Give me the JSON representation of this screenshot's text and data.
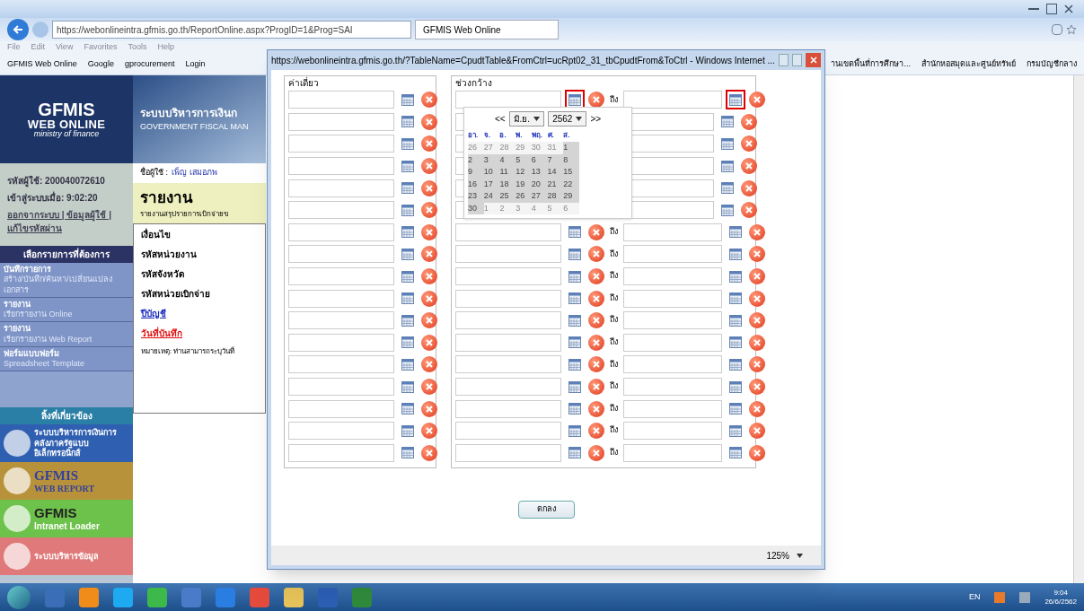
{
  "browser": {
    "address": "https://webonlineintra.gfmis.go.th/ReportOnline.aspx?ProgID=1&Prog=SAI",
    "tab": "GFMIS Web Online",
    "menu": [
      "File",
      "Edit",
      "View",
      "Favorites",
      "Tools",
      "Help"
    ],
    "favorites": [
      "GFMIS Web Online",
      "Google",
      "gprocurement",
      "Login"
    ],
    "favorites_right": [
      "านเขตพื้นที่การศึกษา...",
      "สำนักหอสมุดและศูนย์ทรัพย์",
      "กรมบัญชีกลาง"
    ]
  },
  "page": {
    "logo": {
      "line_1": "GFMIS",
      "line_2": "WEB ONLINE",
      "line_3": "ministry of finance"
    },
    "header": {
      "title": "ระบบบริหารการเงินก",
      "subtitle": "GOVERNMENT FISCAL MAN"
    },
    "user_info": [
      "รหัสผู้ใช้: 200040072610",
      "เข้าสู่ระบบเมื่อ: 9:02:20"
    ],
    "user_links": "ออกจากระบบ | ข้อมูลผู้ใช้ | แก้ไขรหัสผ่าน",
    "menu_heading": "เลือกรายการที่ต้องการ",
    "menu": [
      {
        "title": "บันทึกรายการ",
        "subtitle": "สร้าง/บันทึก/ค้นหา/เปลี่ยนแปลง เอกสาร"
      },
      {
        "title": "รายงาน",
        "subtitle": "เรียกรายงาน Online"
      },
      {
        "title": "รายงาน",
        "subtitle": "เรียกรายงาน Web Report"
      },
      {
        "title": "ฟอร์มแบบฟอร์ม",
        "subtitle": "Spreadsheet Template"
      }
    ],
    "links_heading": "ลิ้งที่เกี่ยวข้อง",
    "banners": [
      {
        "kind": "thai",
        "text": "ระบบบริหารการเงินการคลังภาครัฐแบบอิเล็กทรอนิกส์",
        "color": "#2f5fb0"
      },
      {
        "kind": "report",
        "text": "GFMIS",
        "subtext": "WEB REPORT",
        "color": "#b8923a"
      },
      {
        "kind": "loader",
        "text": "GFMIS",
        "subtext": "Intranet Loader",
        "color": "#6cc24a"
      },
      {
        "kind": "thai",
        "text": "ระบบบริหารข้อมูล",
        "color": "#e07a7a"
      }
    ],
    "user_name_label": "ชื่อผู้ใช้ :",
    "user_name": "เพ็ญ เสมอภพ",
    "report_title": "รายงาน",
    "report_subtitle": "รายงานสรุปรายการเบิกจ่ายข",
    "conditions": [
      {
        "kind": "heading",
        "text": "เงื่อนไข"
      },
      {
        "kind": "label",
        "text": "รหัสหน่วยงาน"
      },
      {
        "kind": "label",
        "text": "รหัสจังหวัด"
      },
      {
        "kind": "label",
        "text": "รหัสหน่วยเบิกจ่าย"
      },
      {
        "kind": "link",
        "text": "ปีบัญชี"
      },
      {
        "kind": "active_link",
        "text": "วันที่บันทึก"
      }
    ],
    "note": "หมายเหตุ: ท่านสามารถระบุวันที่"
  },
  "popup": {
    "title": "https://webonlineintra.gfmis.go.th/?TableName=CpudtTable&FromCtrl=ucRpt02_31_tbCpudtFrom&ToCtrl - Windows Internet ...",
    "single_heading": "ค่าเดี่ยว",
    "range_heading": "ช่วงกว้าง",
    "rows": [
      {
        "to_label": "ถึง",
        "highlighted": true
      },
      {
        "highlighted": false
      },
      {
        "highlighted": false
      },
      {
        "highlighted": false
      },
      {
        "highlighted": false
      },
      {
        "highlighted": false
      },
      {
        "to_label": "ถึง",
        "highlighted": false
      },
      {
        "to_label": "ถึง",
        "highlighted": false
      },
      {
        "to_label": "ถึง",
        "highlighted": false
      },
      {
        "to_label": "ถึง",
        "highlighted": false
      },
      {
        "to_label": "ถึง",
        "highlighted": false
      },
      {
        "to_label": "ถึง",
        "highlighted": false
      },
      {
        "to_label": "ถึง",
        "highlighted": false
      },
      {
        "to_label": "ถึง",
        "highlighted": false
      },
      {
        "to_label": "ถึง",
        "highlighted": false
      },
      {
        "to_label": "ถึง",
        "highlighted": false
      },
      {
        "to_label": "ถึง",
        "highlighted": false
      }
    ],
    "calendar": {
      "prev": "<<",
      "month": "มิ.ย.",
      "year": "2562",
      "next": ">>",
      "weekdays": [
        "อา.",
        "จ.",
        "อ.",
        "พ.",
        "พฤ.",
        "ศ.",
        "ส."
      ],
      "days": [
        {
          "day": "26",
          "other_month": true
        },
        {
          "day": "27",
          "other_month": true
        },
        {
          "day": "28",
          "other_month": true
        },
        {
          "day": "29",
          "other_month": true
        },
        {
          "day": "30",
          "other_month": true
        },
        {
          "day": "31",
          "other_month": true
        },
        {
          "day": "1",
          "other_month": false
        },
        {
          "day": "2",
          "other_month": false
        },
        {
          "day": "3",
          "other_month": false
        },
        {
          "day": "4",
          "other_month": false
        },
        {
          "day": "5",
          "other_month": false
        },
        {
          "day": "6",
          "other_month": false
        },
        {
          "day": "7",
          "other_month": false
        },
        {
          "day": "8",
          "other_month": false
        },
        {
          "day": "9",
          "other_month": false
        },
        {
          "day": "10",
          "other_month": false
        },
        {
          "day": "11",
          "other_month": false
        },
        {
          "day": "12",
          "other_month": false
        },
        {
          "day": "13",
          "other_month": false
        },
        {
          "day": "14",
          "other_month": false
        },
        {
          "day": "15",
          "other_month": false
        },
        {
          "day": "16",
          "other_month": false
        },
        {
          "day": "17",
          "other_month": false
        },
        {
          "day": "18",
          "other_month": false
        },
        {
          "day": "19",
          "other_month": false
        },
        {
          "day": "20",
          "other_month": false
        },
        {
          "day": "21",
          "other_month": false
        },
        {
          "day": "22",
          "other_month": false
        },
        {
          "day": "23",
          "other_month": false
        },
        {
          "day": "24",
          "other_month": false
        },
        {
          "day": "25",
          "other_month": false
        },
        {
          "day": "26",
          "other_month": false
        },
        {
          "day": "27",
          "other_month": false
        },
        {
          "day": "28",
          "other_month": false
        },
        {
          "day": "29",
          "other_month": false
        },
        {
          "day": "30",
          "other_month": false
        },
        {
          "day": "1",
          "other_month": true
        },
        {
          "day": "2",
          "other_month": true
        },
        {
          "day": "3",
          "other_month": true
        },
        {
          "day": "4",
          "other_month": true
        },
        {
          "day": "5",
          "other_month": true
        },
        {
          "day": "6",
          "other_month": true
        }
      ]
    },
    "ok_button": "ตกลง",
    "zoom": "125%"
  },
  "taskbar": {
    "language": "EN",
    "time": "9:04",
    "date": "26/6/2562"
  }
}
